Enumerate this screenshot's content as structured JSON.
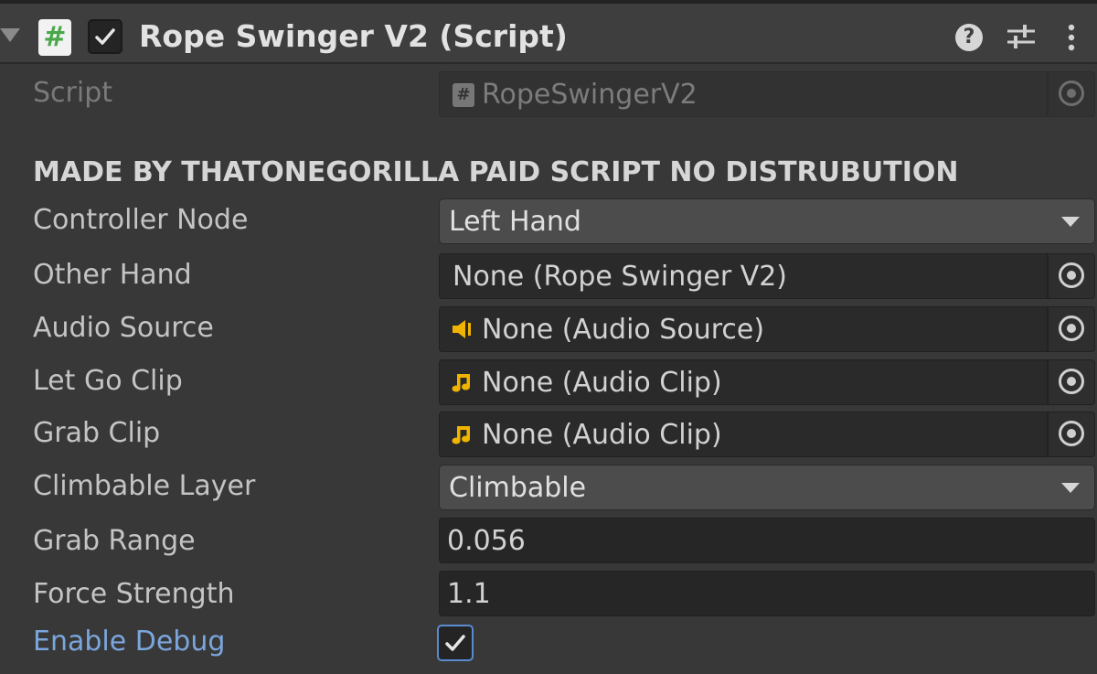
{
  "component": {
    "title": "Rope Swinger V2 (Script)",
    "enabled": true,
    "script_badge": "#"
  },
  "script_field": {
    "label": "Script",
    "value": "RopeSwingerV2",
    "icon": "csharp-script-icon"
  },
  "section_header": "MADE BY THATONEGORILLA PAID SCRIPT NO DISTRUBUTION",
  "fields": {
    "controller_node": {
      "label": "Controller Node",
      "value": "Left Hand"
    },
    "other_hand": {
      "label": "Other Hand",
      "value": "None (Rope Swinger V2)"
    },
    "audio_source": {
      "label": "Audio Source",
      "value": "None (Audio Source)",
      "icon": "audio-source-icon"
    },
    "let_go_clip": {
      "label": "Let Go Clip",
      "value": "None (Audio Clip)",
      "icon": "audio-clip-icon"
    },
    "grab_clip": {
      "label": "Grab Clip",
      "value": "None (Audio Clip)",
      "icon": "audio-clip-icon"
    },
    "climbable_layer": {
      "label": "Climbable Layer",
      "value": "Climbable"
    },
    "grab_range": {
      "label": "Grab Range",
      "value": "0.056"
    },
    "force_strength": {
      "label": "Force Strength",
      "value": "1.1"
    },
    "enable_debug": {
      "label": "Enable Debug",
      "checked": true
    }
  },
  "colors": {
    "background": "#383838",
    "header": "#3e3e3e",
    "field": "#2a2a2a",
    "dropdown": "#4c4c4c",
    "accent_blue": "#7ba6dd",
    "audio_icon_yellow": "#f0b400",
    "script_hash_green": "#4aa84a"
  }
}
